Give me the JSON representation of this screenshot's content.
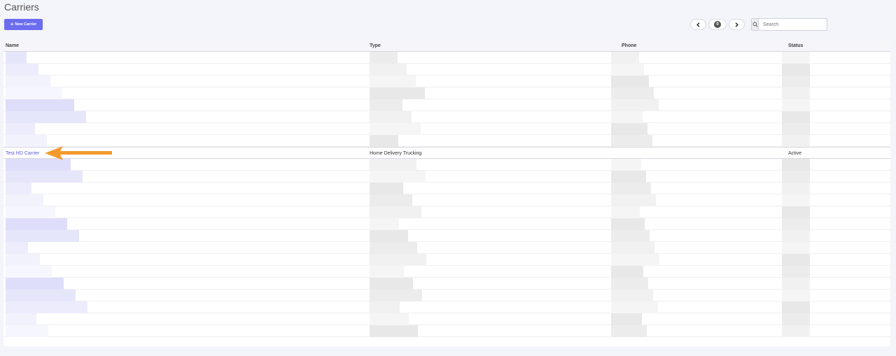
{
  "header": {
    "title": "Carriers",
    "new_button_label": "New Carrier"
  },
  "pager": {
    "prev_icon": "chevron-left-icon",
    "page": "0",
    "next_icon": "chevron-right-icon"
  },
  "search": {
    "placeholder": "Search",
    "value": ""
  },
  "table": {
    "columns": [
      "Name",
      "Type",
      "Phone",
      "Status"
    ],
    "highlighted_row": {
      "name": "Test HD Carrier",
      "type": "Home Delivery Trucking",
      "phone": "",
      "status": "Active"
    }
  },
  "colors": {
    "accent": "#6c6cf0",
    "link": "#5b5bdd",
    "annotation_arrow": "#f39a2e"
  }
}
